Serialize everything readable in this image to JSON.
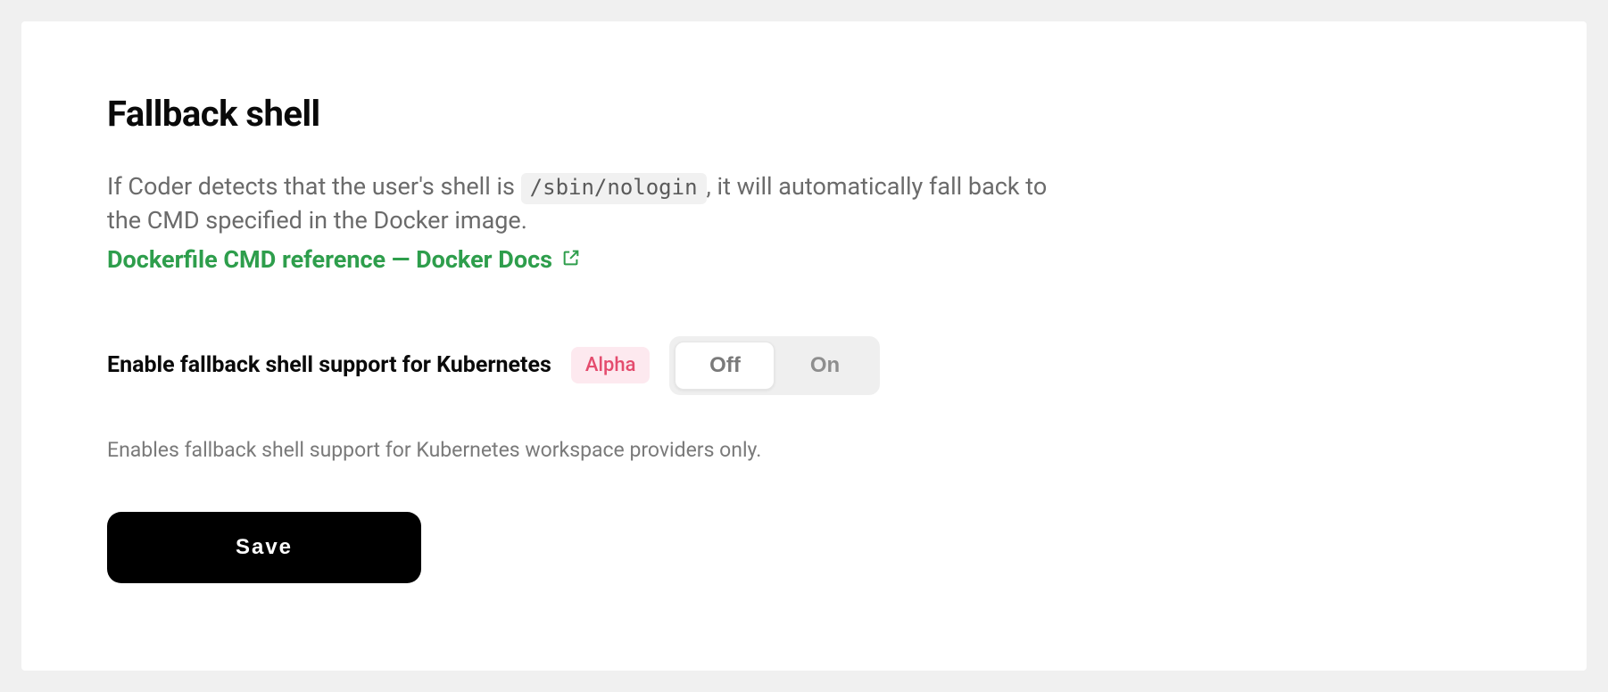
{
  "title": "Fallback shell",
  "description": {
    "part1": "If Coder detects that the user's shell is ",
    "code": "/sbin/nologin",
    "part2": ", it will automatically fall back to the CMD specified in the Docker image."
  },
  "doc_link": {
    "label": "Dockerfile CMD reference — Docker Docs"
  },
  "setting": {
    "label": "Enable fallback shell support for Kubernetes",
    "badge": "Alpha",
    "toggle": {
      "off": "Off",
      "on": "On",
      "selected": "off"
    },
    "help": "Enables fallback shell support for Kubernetes workspace providers only."
  },
  "save_button": "Save",
  "colors": {
    "accent_green": "#2e9e4c",
    "badge_bg": "#fde9ef",
    "badge_text": "#e44c6e"
  }
}
